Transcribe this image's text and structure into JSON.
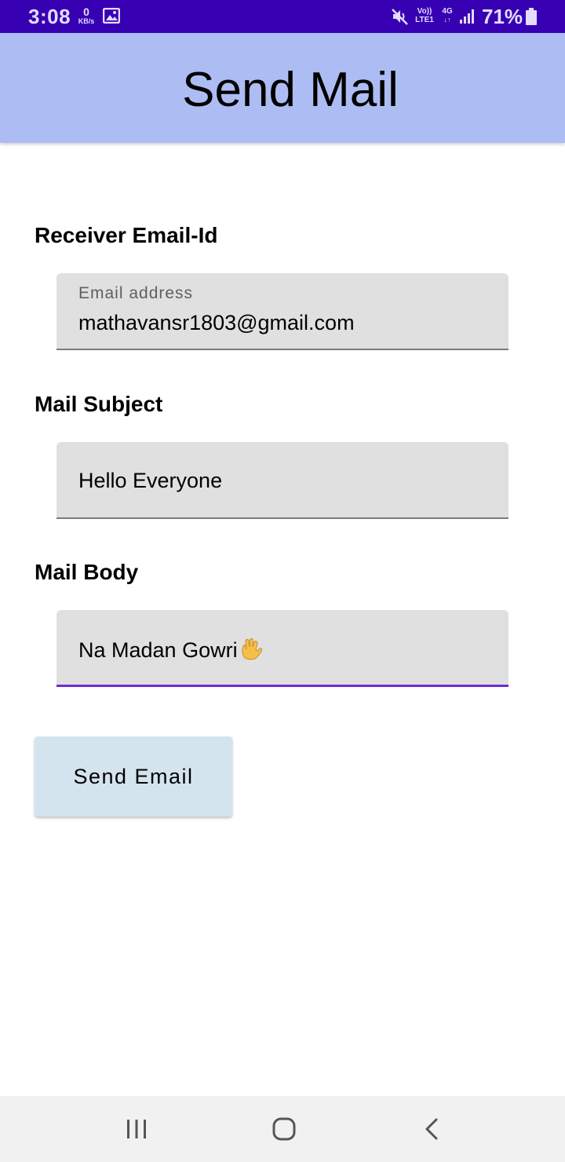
{
  "status_bar": {
    "time": "3:08",
    "data_speed_value": "0",
    "data_speed_unit": "KB/s",
    "volte_top": "Vo))",
    "volte_bottom": "LTE1",
    "network_type": "4G",
    "network_arrows": "↓↑",
    "battery_percent": "71%",
    "background_color": "#3700b3"
  },
  "app_bar": {
    "title": "Send Mail",
    "background_color": "#adbdf3"
  },
  "form": {
    "receiver": {
      "label": "Receiver Email-Id",
      "floating_label": "Email address",
      "value": "mathavansr1803@gmail.com"
    },
    "subject": {
      "label": "Mail Subject",
      "value": "Hello Everyone"
    },
    "body": {
      "label": "Mail Body",
      "value": "Na Madan Gowri",
      "emoji": "vulcan-salute-emoji"
    },
    "send_button": {
      "label": "Send Email",
      "background_color": "#d4e4ef"
    },
    "focus_color": "#6a2fd6"
  },
  "nav_bar": {
    "recents_icon": "recents-icon",
    "home_icon": "home-icon",
    "back_icon": "back-icon"
  }
}
